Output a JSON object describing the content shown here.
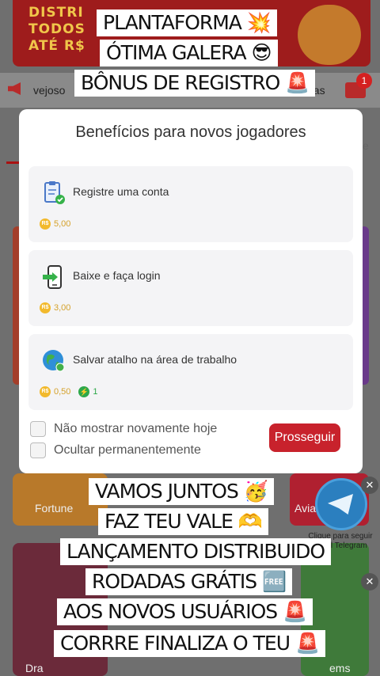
{
  "background": {
    "banner_text": "DISTRI TODOS ATÉ R$",
    "ticker_left": "vejoso",
    "ticker_right": "nas",
    "mail_badge": "1",
    "side_right": "e",
    "tiles": [
      {
        "label": "Fortune"
      },
      {
        "label": "Avia"
      },
      {
        "label": "Dra"
      },
      {
        "label": "ems"
      }
    ],
    "telegram_label": "Clique para seguir canal Telegram",
    "close_symbol": "✕"
  },
  "modal": {
    "title": "Benefícios para novos jogadores",
    "cards": [
      {
        "label": "Registre uma conta",
        "icon": "clipboard-check-icon",
        "reward": "5,00"
      },
      {
        "label": "Baixe e faça login",
        "icon": "phone-login-icon",
        "reward": "3,00"
      },
      {
        "label": "Salvar atalho na área de trabalho",
        "icon": "globe-icon",
        "reward": "0,50",
        "bolt": "1"
      }
    ],
    "coin_symbol": "R$",
    "bolt_symbol": "⚡",
    "options": [
      {
        "label": "Não mostrar novamente hoje"
      },
      {
        "label": "Ocultar permanentemente"
      }
    ],
    "proceed_label": "Prosseguir"
  },
  "captions_top": [
    "PLANTAFORMA 💥",
    "ÓTIMA GALERA 😎",
    "BÔNUS DE REGISTRO 🚨"
  ],
  "captions_bottom": [
    "VAMOS JUNTOS 🥳",
    "FAZ TEU VALE 🫶",
    "LANÇAMENTO DISTRIBUIDO",
    "RODADAS GRÁTIS 🆓",
    "AOS NOVOS USUÁRIOS 🚨",
    "CORRRE FINALIZA O TEU 🚨"
  ],
  "colors": {
    "accent": "#c8222c",
    "coin": "#f2b92c",
    "bolt": "#2ea84a"
  }
}
